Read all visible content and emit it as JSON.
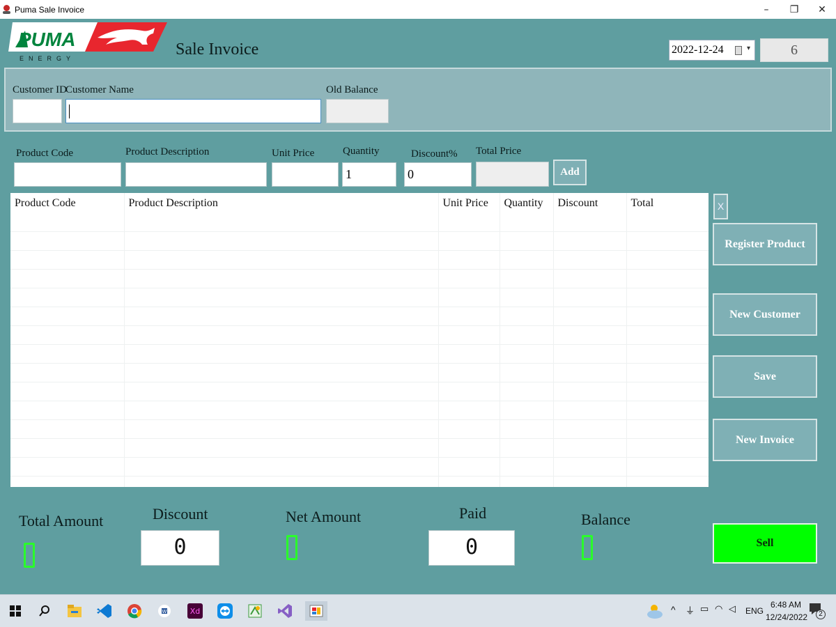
{
  "window": {
    "title": "Puma Sale Invoice",
    "minimize": "–",
    "restore": "❐",
    "close": "✕"
  },
  "header": {
    "logo_word": "PUMA",
    "logo_sub": "ENERGY",
    "page_title": "Sale Invoice",
    "date": "2022-12-24",
    "invoice_no": "6"
  },
  "customer": {
    "id_label": "Customer ID",
    "name_label": "Customer Name",
    "old_balance_label": "Old Balance",
    "id_value": "",
    "name_value": "",
    "old_balance_value": ""
  },
  "entry": {
    "product_code_label": "Product Code",
    "product_desc_label": "Product Description",
    "unit_price_label": "Unit Price",
    "quantity_label": "Quantity",
    "discount_label": "Discount%",
    "total_price_label": "Total Price",
    "product_code_value": "",
    "product_desc_value": "",
    "unit_price_value": "",
    "quantity_value": "1",
    "discount_value": "0",
    "total_price_value": "",
    "add_label": "Add"
  },
  "grid": {
    "columns": [
      "Product Code",
      "Product Description",
      "Unit Price",
      "Quantity",
      "Discount",
      "Total"
    ],
    "rows": []
  },
  "side": {
    "remove_label": "X",
    "register_product": "Register Product",
    "new_customer": "New Customer",
    "save": "Save",
    "new_invoice": "New Invoice",
    "sell": "Sell"
  },
  "totals": {
    "total_amount_label": "Total Amount",
    "discount_label": "Discount",
    "net_amount_label": "Net Amount",
    "paid_label": "Paid",
    "balance_label": "Balance",
    "discount_value": "0",
    "paid_value": "0"
  },
  "taskbar": {
    "icons": [
      "windows-icon",
      "search-icon",
      "file-explorer-icon",
      "vscode-icon",
      "chrome-icon",
      "word-icon",
      "xd-icon",
      "teamviewer-icon",
      "app-icon",
      "visual-studio-icon",
      "running-app-icon"
    ],
    "language": "ENG",
    "time": "6:48 AM",
    "date": "12/24/2022",
    "notifications": "2"
  },
  "colors": {
    "background": "#5f9ea0",
    "panel": "#8fb5ba",
    "button": "#7fb0b5",
    "sell": "#00ff00",
    "digit": "#2aff2a",
    "logo_red": "#e8262e",
    "logo_green": "#00843d"
  }
}
